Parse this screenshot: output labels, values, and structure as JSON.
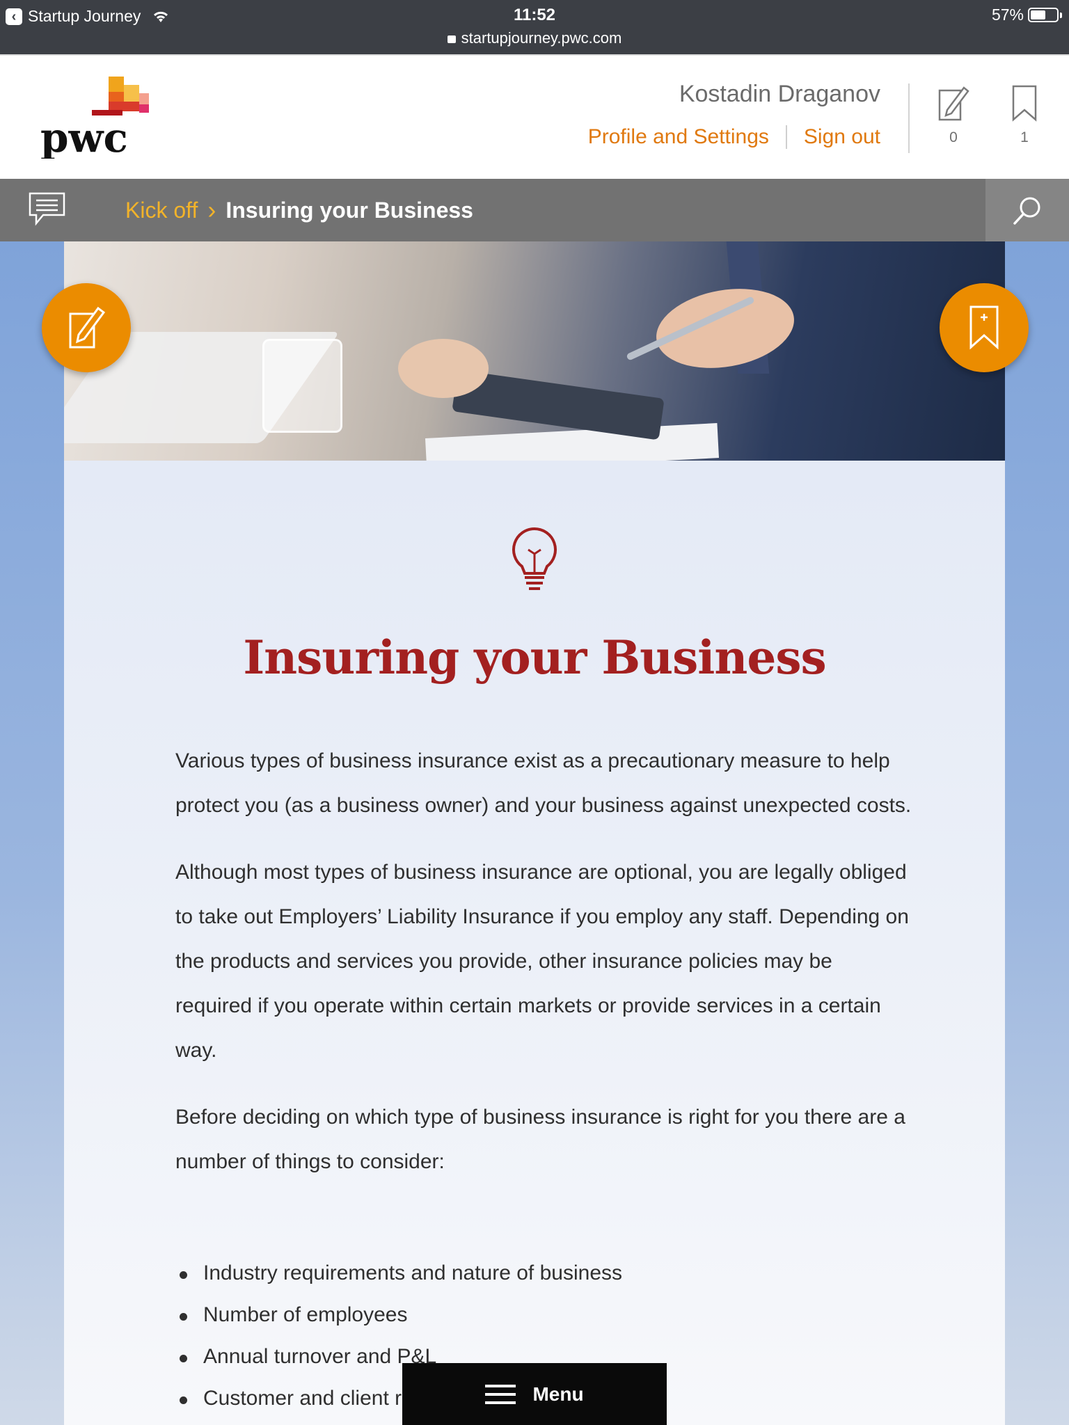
{
  "status_bar": {
    "back_app": "Startup Journey",
    "time": "11:52",
    "url": "startupjourney.pwc.com",
    "battery": "57%",
    "battery_level": 0.57
  },
  "header": {
    "logo_text": "pwc",
    "user_name": "Kostadin Draganov",
    "profile_link": "Profile and Settings",
    "signout_link": "Sign out",
    "notes_count": "0",
    "bookmarks_count": "1"
  },
  "breadcrumb": {
    "parent": "Kick off",
    "current": "Insuring your Business"
  },
  "article": {
    "title": "Insuring your Business",
    "paragraphs": [
      "Various types of business insurance exist as a precautionary measure to help protect you (as a business owner) and your business against unexpected costs.",
      "Although most types of business insurance are optional, you are legally obliged to take out Employers’ Liability Insurance if you employ any staff. Depending on the products and services you provide, other insurance policies may be required if you operate within certain markets or provide services in a certain way.",
      "Before deciding on which type of business insurance is right for you there are a number of things to consider:"
    ],
    "list": [
      "Industry requirements and nature of business",
      "Number of employees",
      "Annual turnover and P&L",
      "Customer and client requirements or expectations"
    ]
  },
  "menu": {
    "label": "Menu"
  },
  "colors": {
    "accent_orange": "#eb8c00",
    "link_orange": "#e0790f",
    "title_red": "#a32020",
    "breadcrumb_gold": "#f2b32a"
  },
  "icons": [
    "back-icon",
    "wifi-icon",
    "lock-icon",
    "battery-icon",
    "pencil-icon",
    "bookmark-icon",
    "chat-icon",
    "search-icon",
    "lightbulb-icon",
    "hamburger-icon"
  ]
}
